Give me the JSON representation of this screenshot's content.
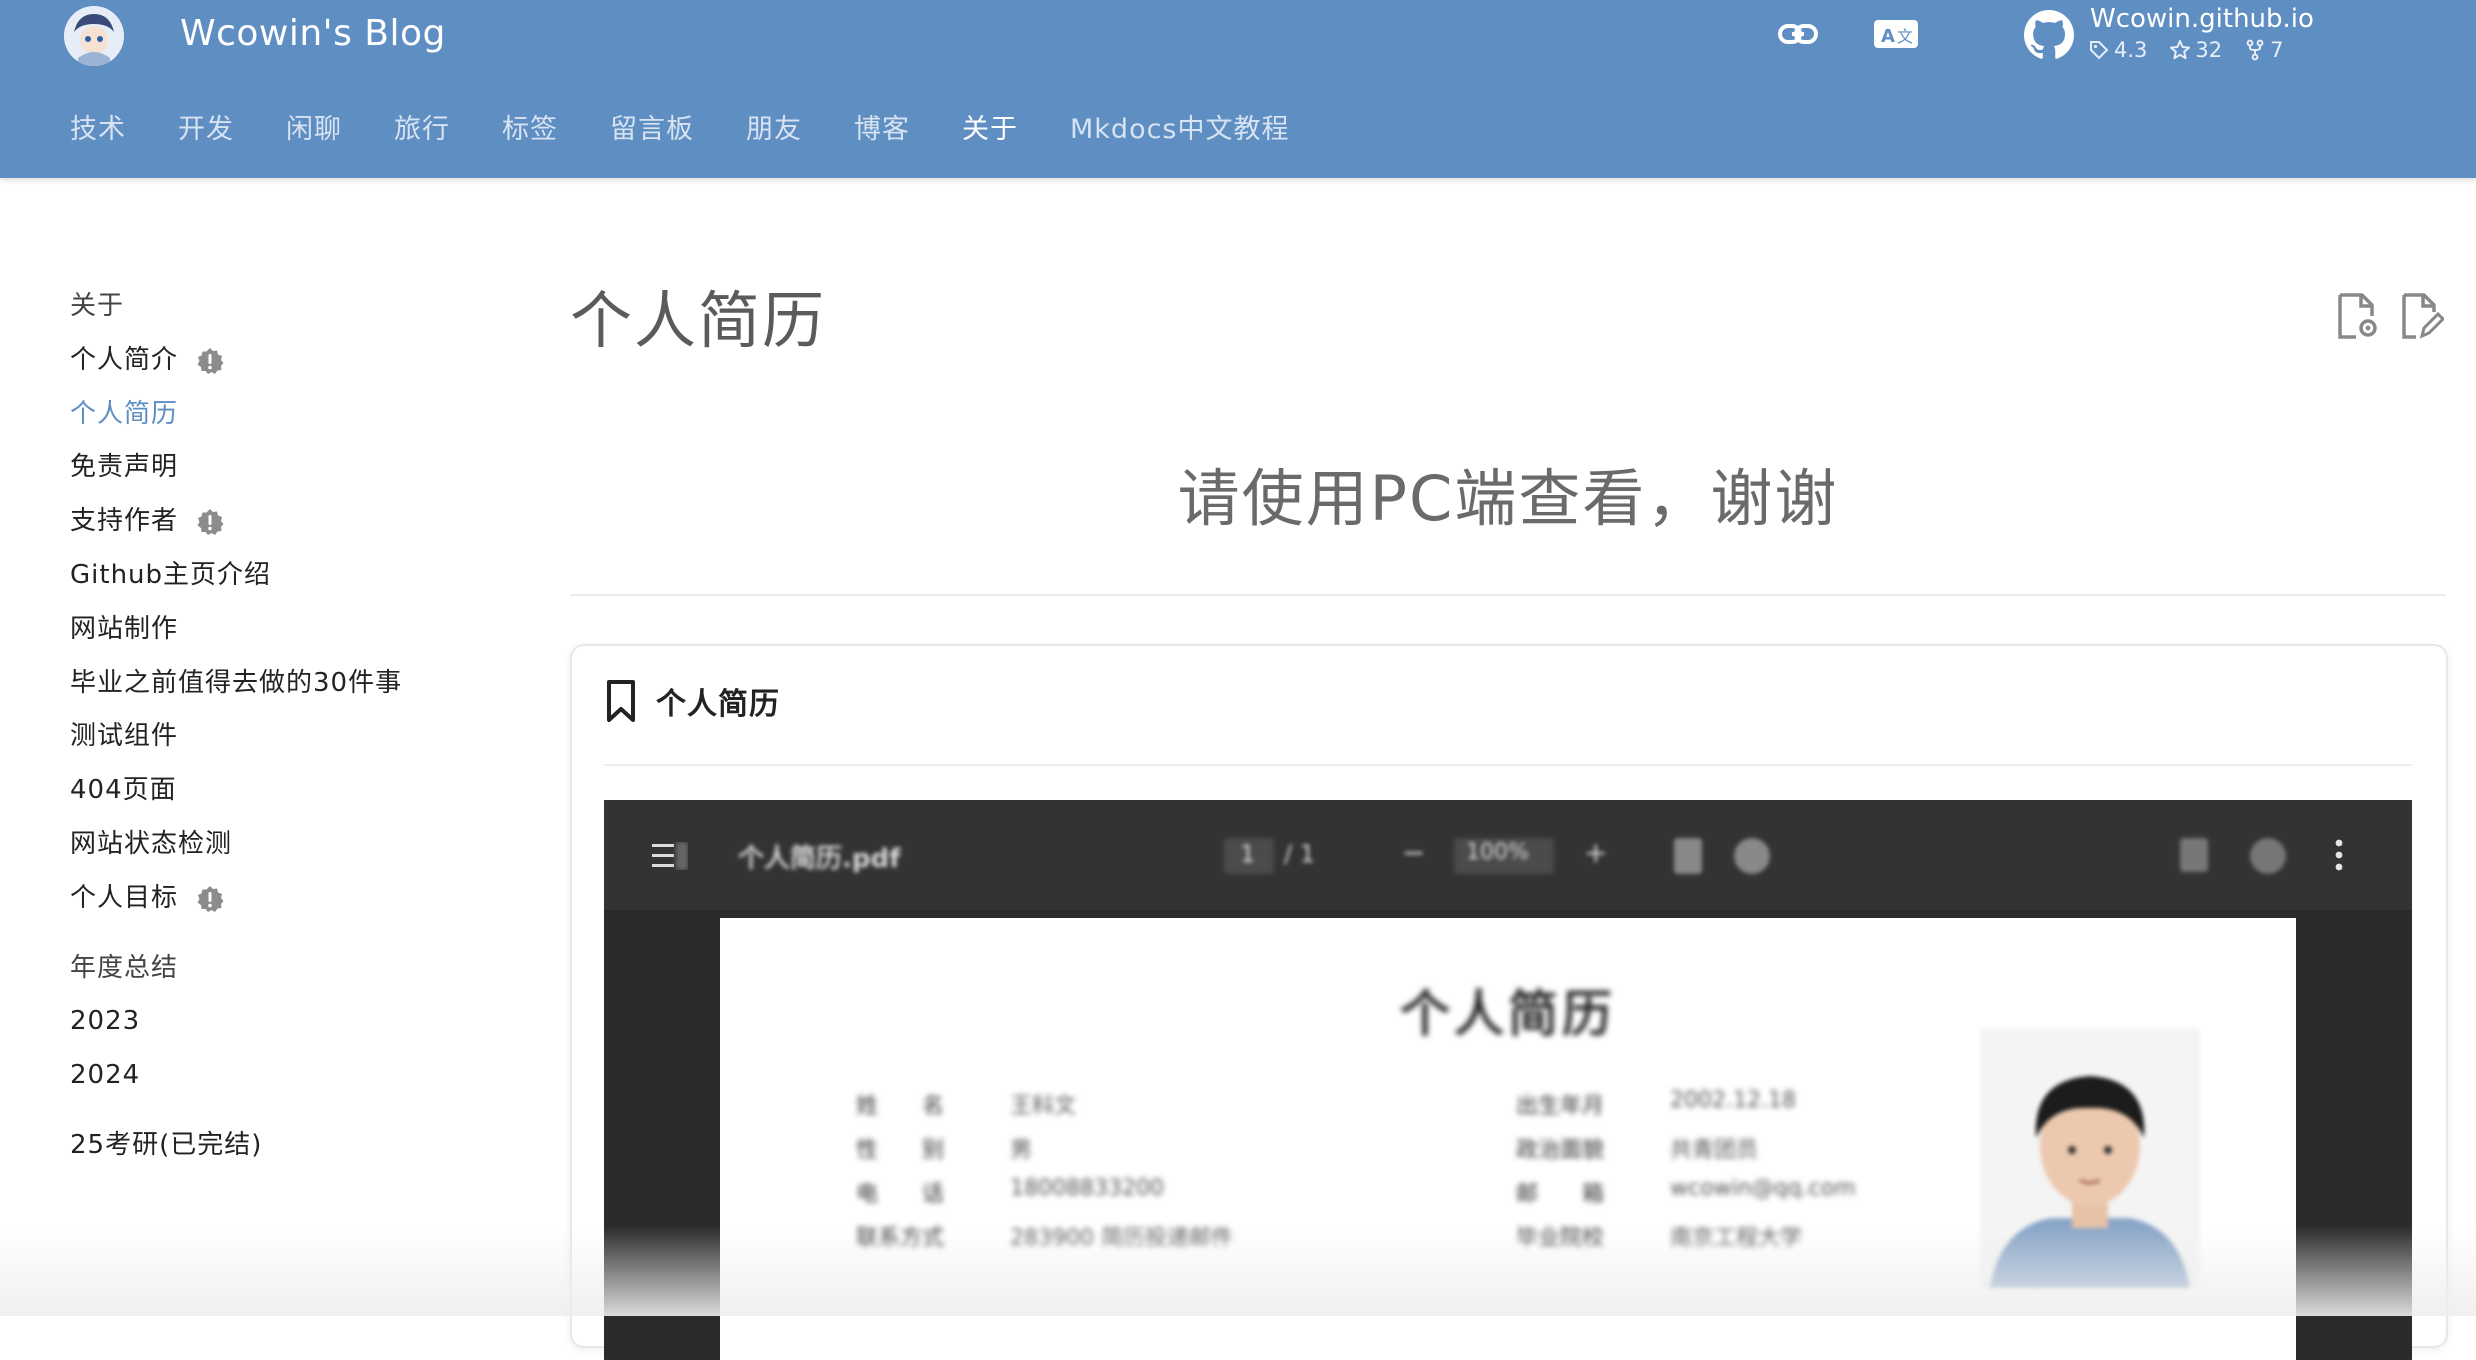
{
  "header": {
    "site_title": "Wcowin's Blog",
    "repo": {
      "name": "Wcowin.github.io",
      "version": "4.3",
      "stars": "32",
      "forks": "7"
    },
    "tabs": [
      {
        "label": "技术"
      },
      {
        "label": "开发"
      },
      {
        "label": "闲聊"
      },
      {
        "label": "旅行"
      },
      {
        "label": "标签"
      },
      {
        "label": "留言板"
      },
      {
        "label": "朋友"
      },
      {
        "label": "博客"
      },
      {
        "label": "关于"
      },
      {
        "label": "Mkdocs中文教程"
      }
    ],
    "active_tab": "关于",
    "icons": [
      "link-icon",
      "translate-icon",
      "github-icon"
    ]
  },
  "sidebar": {
    "items": [
      {
        "label": "关于",
        "kind": "section"
      },
      {
        "label": "个人简介",
        "badge": true
      },
      {
        "label": "个人简历",
        "current": true
      },
      {
        "label": "免责声明"
      },
      {
        "label": "支持作者",
        "badge": true
      },
      {
        "label": "Github主页介绍"
      },
      {
        "label": "网站制作"
      },
      {
        "label": "毕业之前值得去做的30件事"
      },
      {
        "label": "测试组件"
      },
      {
        "label": "404页面"
      },
      {
        "label": "网站状态检测"
      },
      {
        "label": "个人目标",
        "badge": true
      },
      {
        "label": "年度总结",
        "kind": "section"
      },
      {
        "label": "2023"
      },
      {
        "label": "2024"
      },
      {
        "label": "25考研(已完结)"
      }
    ]
  },
  "main": {
    "title": "个人简历",
    "notice": "请使用PC端查看，谢谢",
    "card_title": "个人简历"
  },
  "pdf_viewer": {
    "file_name": "个人简历.pdf",
    "page_current": "1",
    "page_total": "/ 1",
    "zoom": "100%",
    "doc_title": "个人简历",
    "left_fields": [
      {
        "key": "姓　　名",
        "value": "王科文"
      },
      {
        "key": "性　　别",
        "value": "男"
      },
      {
        "key": "电　　话",
        "value": "18008833200"
      },
      {
        "key": "联系方式",
        "value": "283900 简历投递邮件"
      }
    ],
    "right_fields": [
      {
        "key": "出生年月",
        "value": "2002.12.18"
      },
      {
        "key": "政治面貌",
        "value": "共青团员"
      },
      {
        "key": "邮　　箱",
        "value": "wcowin@qq.com"
      },
      {
        "key": "毕业院校",
        "value": "南京工程大学"
      }
    ]
  },
  "colors": {
    "header_bg": "#5f8ec3",
    "accent": "#5f8ec3",
    "badge": "#8c8c8c"
  }
}
